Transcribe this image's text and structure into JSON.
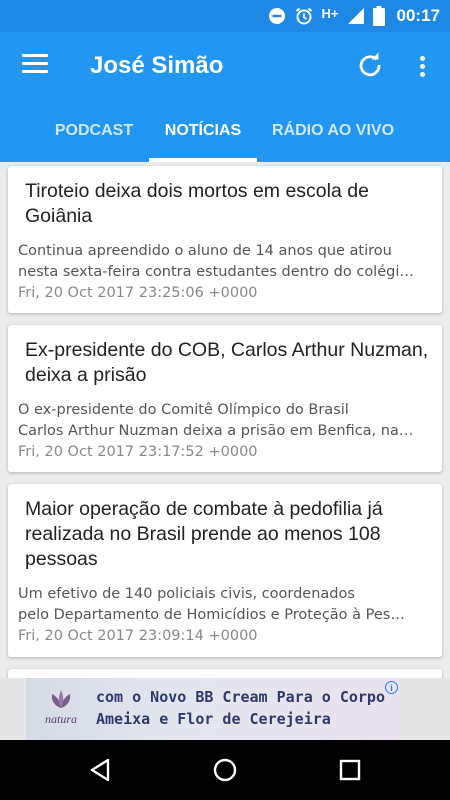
{
  "status_bar": {
    "time": "00:17",
    "network": "H+",
    "icons": [
      "do-not-disturb-icon",
      "alarm-icon",
      "signal-icon",
      "battery-icon"
    ]
  },
  "app_bar": {
    "title": "José Simão",
    "icons": [
      "menu-icon",
      "refresh-icon",
      "overflow-menu-icon"
    ]
  },
  "tabs": [
    {
      "label": "PODCAST",
      "active": false
    },
    {
      "label": "NOTÍCIAS",
      "active": true
    },
    {
      "label": "RÁDIO AO VIVO",
      "active": false
    }
  ],
  "articles": [
    {
      "title_lines": [
        "Tiroteio deixa dois mortos em escola de",
        "Goiânia"
      ],
      "desc_lines": [
        "Continua apreendido o aluno de 14 anos que atirou",
        "nesta sexta-feira contra estudantes dentro do colégi…"
      ],
      "date": "Fri, 20 Oct 2017 23:25:06 +0000"
    },
    {
      "title_lines": [
        "Ex-presidente do COB, Carlos Arthur Nuzman,",
        "deixa a prisão"
      ],
      "desc_lines": [
        "O ex-presidente do Comitê Olímpico do Brasil",
        "Carlos Arthur Nuzman deixa a prisão em Benfica, na…"
      ],
      "date": "Fri, 20 Oct 2017 23:17:52 +0000"
    },
    {
      "title_lines": [
        "Maior operação de combate à pedofilia já",
        "realizada no Brasil prende ao menos 108",
        "pessoas"
      ],
      "desc_lines": [
        "Um efetivo de 140 policiais civis, coordenados",
        "pelo Departamento de Homicídios e Proteção à Pes…"
      ],
      "date": "Fri, 20 Oct 2017 23:09:14 +0000"
    }
  ],
  "ad": {
    "brand": "natura",
    "lines": [
      "com o Novo BB Cream Para o Corpo",
      "Ameixa e Flor de Cerejeira"
    ],
    "info": "i"
  },
  "colors": {
    "status_bar": "#1e88e5",
    "app_bar": "#2196f3",
    "background": "#ececec"
  }
}
